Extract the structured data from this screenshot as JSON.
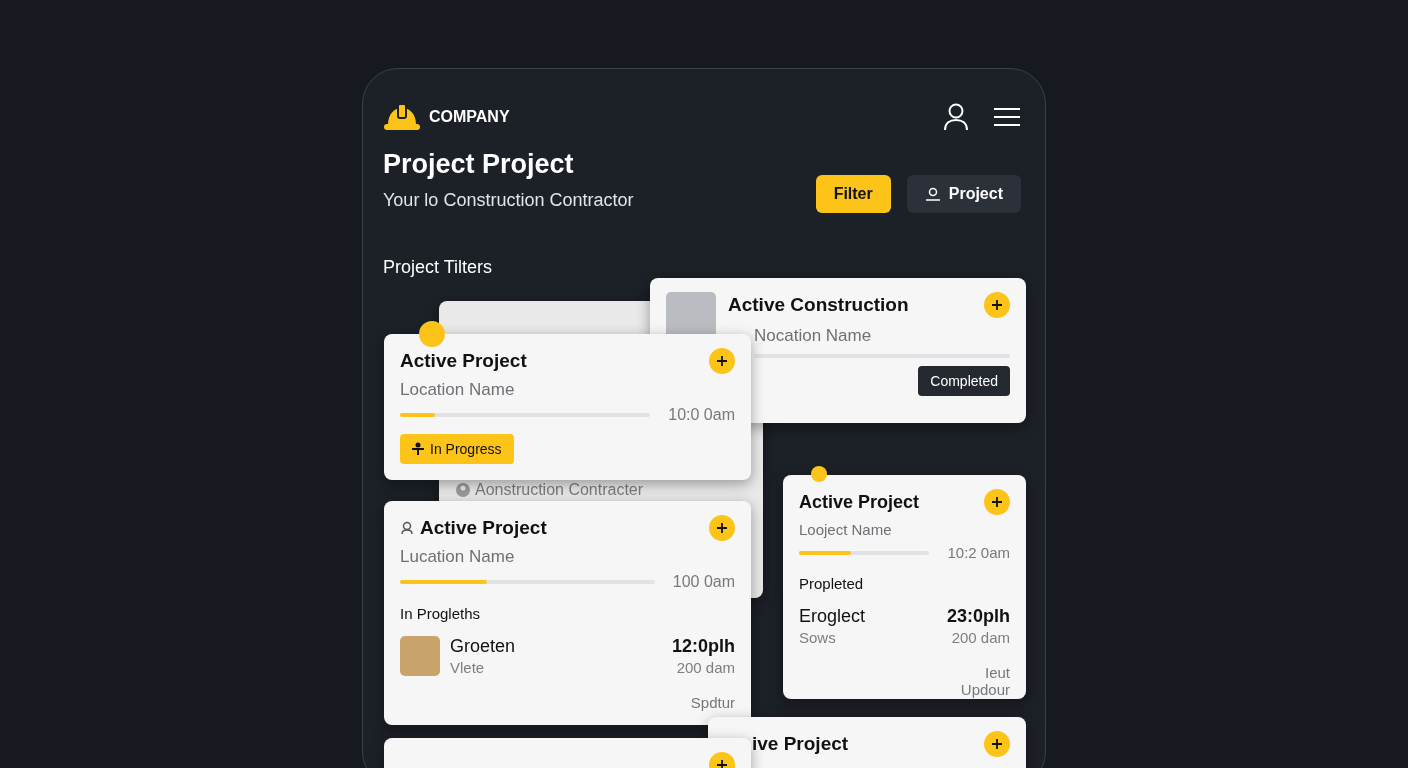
{
  "header": {
    "brand": "COMPANY",
    "title": "Project Project",
    "subtitle": "Your lo Construction Contractor",
    "buttons": [
      {
        "label": "Filter",
        "kind": "primary"
      },
      {
        "label": "Project",
        "kind": "secondary"
      }
    ]
  },
  "section_title": "Project Tilters",
  "cards": [
    {
      "kind": "backdrop",
      "footer": "Aonstruction Contracter"
    },
    {
      "kind": "photo",
      "title": "Active Construction",
      "location": "Nocation Name",
      "status": {
        "label": "Completed",
        "kind": "done"
      }
    },
    {
      "kind": "progress",
      "title": "Active Project",
      "location": "Location Name",
      "level": 0.14,
      "time": "10:0 0am",
      "status": {
        "label": "In Progress",
        "kind": "active"
      }
    },
    {
      "kind": "detail",
      "title": "Active Project",
      "location": "Lucation Name",
      "level": 0.34,
      "time": "100 0am",
      "section": "In Progleths",
      "entry": {
        "name": "Groeten",
        "sub": "Vlete",
        "time": "12:0plh",
        "sub_time": "200 dam",
        "photo": true
      },
      "footer": [
        "Spdtur"
      ]
    },
    {
      "kind": "detail",
      "title": "Active Project",
      "location": "Looject Name",
      "level": 0.4,
      "time": "10:2 0am",
      "section": "Propleted",
      "entry": {
        "name": "Eroglect",
        "sub": "Sows",
        "time": "23:0plh",
        "sub_time": "200 dam",
        "photo": false
      },
      "footer": [
        "Ieut",
        "Updour"
      ]
    },
    {
      "kind": "stub",
      "title": "ive Project"
    },
    {
      "kind": "stub"
    }
  ]
}
